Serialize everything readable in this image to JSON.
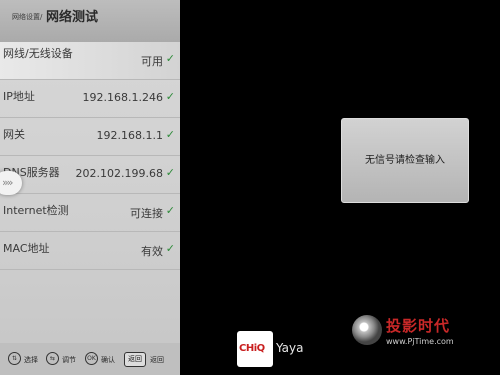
{
  "panel": {
    "breadcrumb": "网络设置/",
    "title": "网络测试",
    "rows": [
      {
        "label": "网线/无线设备",
        "value": "可用",
        "status": "ok"
      },
      {
        "label": "IP地址",
        "value": "192.168.1.246",
        "status": "ok"
      },
      {
        "label": "网关",
        "value": "192.168.1.1",
        "status": "ok"
      },
      {
        "label": "DNS服务器",
        "value": "202.102.199.68",
        "status": "ok"
      },
      {
        "label": "Internet检测",
        "value": "可连接",
        "status": "ok"
      },
      {
        "label": "MAC地址",
        "value": "有效",
        "status": "ok"
      }
    ],
    "check_glyph": "✓",
    "handle_glyph": "»»"
  },
  "bottom_hints": {
    "select": "选择",
    "adjust": "调节",
    "confirm_icon": "OK",
    "confirm": "确认",
    "back_button": "返回",
    "back": "返回"
  },
  "dialog": {
    "message": "无信号请检查输入"
  },
  "brand": {
    "logo_text": "CHiQ",
    "assistant": "Yaya"
  },
  "watermark": {
    "title": "投影时代",
    "url": "www.PjTime.com"
  },
  "colors": {
    "check": "#2e8b3a",
    "logo_red": "#c81e1e",
    "watermark_red": "#c82828"
  }
}
